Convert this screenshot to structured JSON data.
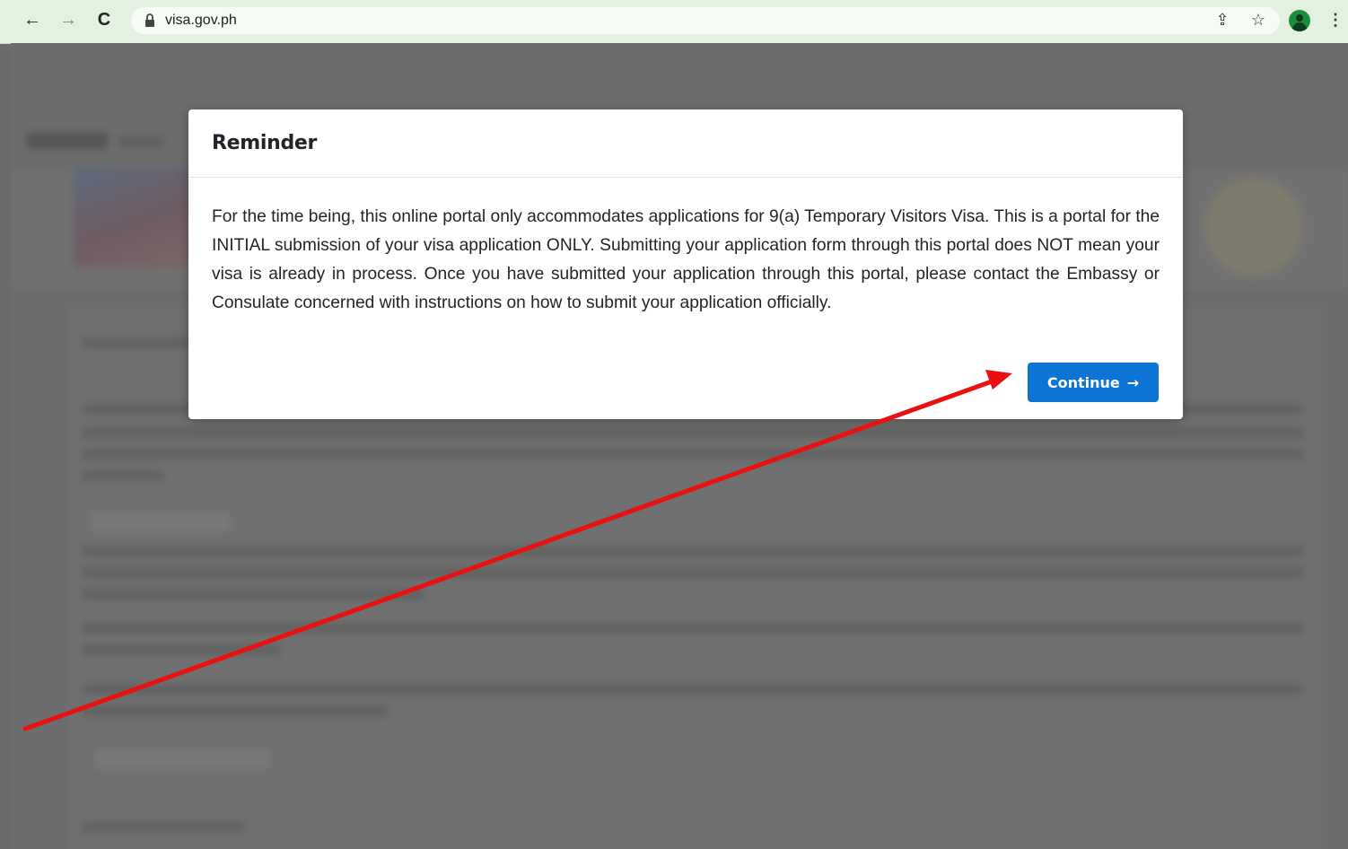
{
  "browser": {
    "url": "visa.gov.ph",
    "back_glyph": "←",
    "forward_glyph": "→",
    "reload_glyph": "C",
    "share_glyph": "⇪",
    "star_glyph": "☆",
    "menu_glyph": "⋮"
  },
  "modal": {
    "title": "Reminder",
    "body": "For the time being, this online portal only accommodates applications for 9(a) Temporary Visitors Visa. This is a portal for the INITIAL submission of your visa application ONLY. Submitting your application form through this portal does NOT mean your visa is already in process. Once you have submitted your application through this portal, please contact the Embassy or Consulate concerned with instructions on how to submit your application officially.",
    "continue_label": "Continue",
    "continue_arrow": "→"
  },
  "colors": {
    "accent": "#0b74d5",
    "annotation_arrow": "#e81010",
    "overlay": "#6b6b6b"
  }
}
